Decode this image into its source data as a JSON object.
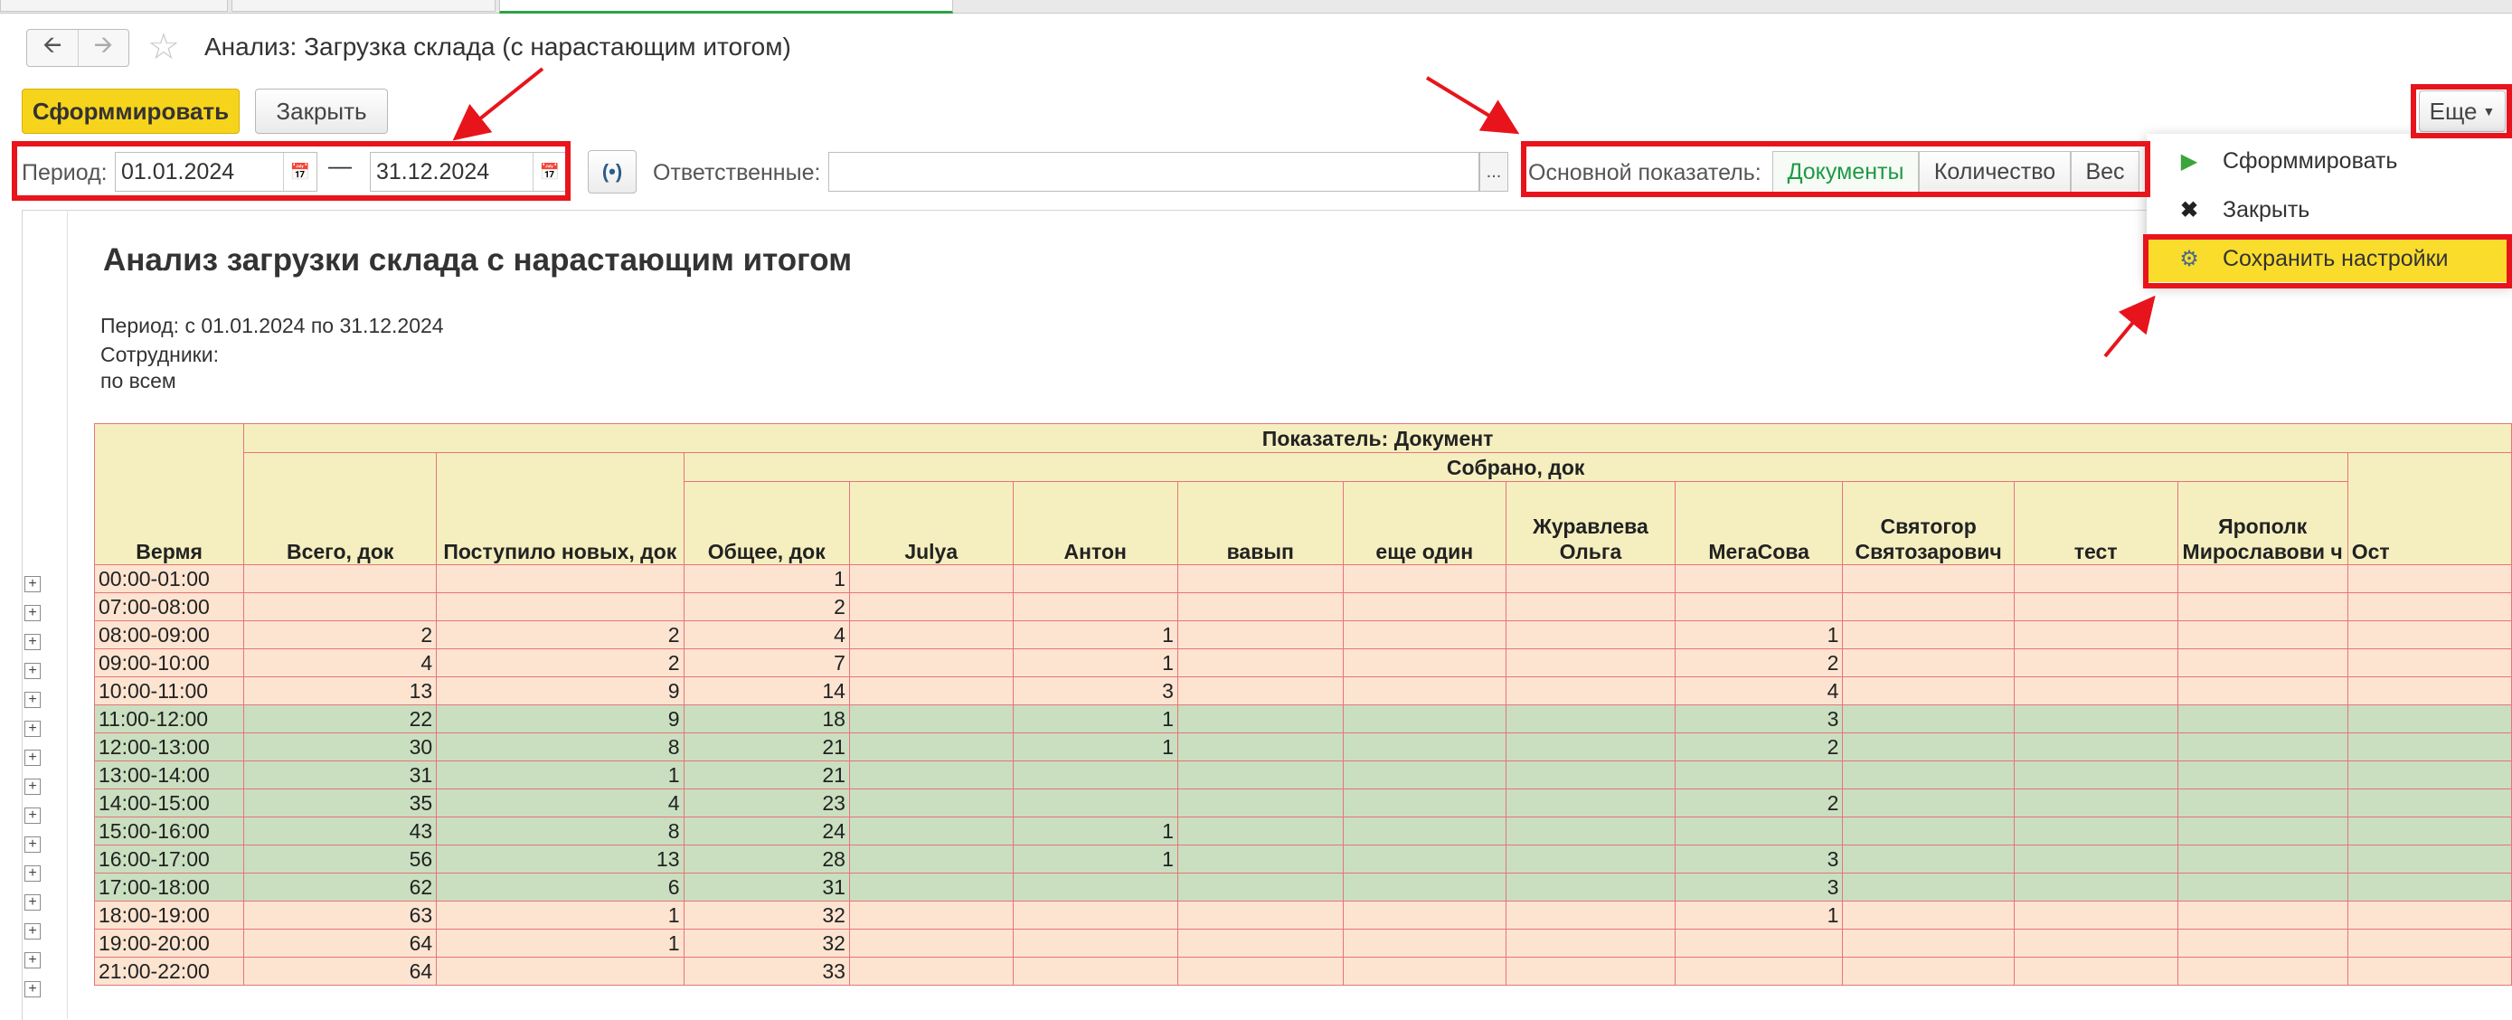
{
  "window": {
    "title": "Анализ: Загрузка склада (с нарастающим итогом)"
  },
  "toolbar": {
    "generate_label": "Сформмировать",
    "close_label": "Закрыть",
    "more_label": "Еще"
  },
  "filters": {
    "period_label": "Период:",
    "date_from": "01.01.2024",
    "date_to": "31.12.2024",
    "dash": "—",
    "responsible_label": "Ответственные:",
    "responsible_value": "",
    "dots": "...",
    "indicator_label": "Основной показатель:",
    "indicator_options": [
      "Документы",
      "Количество",
      "Вес"
    ],
    "indicator_selected": "Документы"
  },
  "menu": {
    "items": [
      {
        "label": "Сформмировать",
        "icon": "play-icon"
      },
      {
        "label": "Закрыть",
        "icon": "close-icon"
      },
      {
        "label": "Сохранить настройки",
        "icon": "settings-save-icon",
        "highlighted": true
      }
    ]
  },
  "report": {
    "title": "Анализ загрузки склада с нарастающим итогом",
    "period_line": "Период: с 01.01.2024 по 31.12.2024",
    "employees_label": "Сотрудники:",
    "employees_value": "по всем",
    "header_indicator": "Показатель: Документ",
    "header_collected": "Собрано, док",
    "columns": [
      "Вермя",
      "Всего, док",
      "Поступило новых, док",
      "Общее, док",
      "Julya",
      "Антон",
      "вавып",
      "еще один",
      "Журавлева Ольга",
      "МегаСова",
      "Святогор Святозарович",
      "тест",
      "Ярополк Мирославови ч",
      "Ост"
    ],
    "rows": [
      {
        "time": "00:00-01:00",
        "total": "",
        "new": "",
        "overall": "1",
        "julya": "",
        "anton": "",
        "vavyp": "",
        "eshe": "",
        "zhur": "",
        "mega": "",
        "svyat": "",
        "test": "",
        "yarop": "",
        "style": "peach"
      },
      {
        "time": "07:00-08:00",
        "total": "",
        "new": "",
        "overall": "2",
        "julya": "",
        "anton": "",
        "vavyp": "",
        "eshe": "",
        "zhur": "",
        "mega": "",
        "svyat": "",
        "test": "",
        "yarop": "",
        "style": "peach"
      },
      {
        "time": "08:00-09:00",
        "total": "2",
        "new": "2",
        "overall": "4",
        "julya": "",
        "anton": "1",
        "vavyp": "",
        "eshe": "",
        "zhur": "",
        "mega": "1",
        "svyat": "",
        "test": "",
        "yarop": "",
        "style": "peach"
      },
      {
        "time": "09:00-10:00",
        "total": "4",
        "new": "2",
        "overall": "7",
        "julya": "",
        "anton": "1",
        "vavyp": "",
        "eshe": "",
        "zhur": "",
        "mega": "2",
        "svyat": "",
        "test": "",
        "yarop": "",
        "style": "peach"
      },
      {
        "time": "10:00-11:00",
        "total": "13",
        "new": "9",
        "overall": "14",
        "julya": "",
        "anton": "3",
        "vavyp": "",
        "eshe": "",
        "zhur": "",
        "mega": "4",
        "svyat": "",
        "test": "",
        "yarop": "",
        "style": "peach"
      },
      {
        "time": "11:00-12:00",
        "total": "22",
        "new": "9",
        "overall": "18",
        "julya": "",
        "anton": "1",
        "vavyp": "",
        "eshe": "",
        "zhur": "",
        "mega": "3",
        "svyat": "",
        "test": "",
        "yarop": "",
        "style": "green"
      },
      {
        "time": "12:00-13:00",
        "total": "30",
        "new": "8",
        "overall": "21",
        "julya": "",
        "anton": "1",
        "vavyp": "",
        "eshe": "",
        "zhur": "",
        "mega": "2",
        "svyat": "",
        "test": "",
        "yarop": "",
        "style": "green"
      },
      {
        "time": "13:00-14:00",
        "total": "31",
        "new": "1",
        "overall": "21",
        "julya": "",
        "anton": "",
        "vavyp": "",
        "eshe": "",
        "zhur": "",
        "mega": "",
        "svyat": "",
        "test": "",
        "yarop": "",
        "style": "green"
      },
      {
        "time": "14:00-15:00",
        "total": "35",
        "new": "4",
        "overall": "23",
        "julya": "",
        "anton": "",
        "vavyp": "",
        "eshe": "",
        "zhur": "",
        "mega": "2",
        "svyat": "",
        "test": "",
        "yarop": "",
        "style": "green"
      },
      {
        "time": "15:00-16:00",
        "total": "43",
        "new": "8",
        "overall": "24",
        "julya": "",
        "anton": "1",
        "vavyp": "",
        "eshe": "",
        "zhur": "",
        "mega": "",
        "svyat": "",
        "test": "",
        "yarop": "",
        "style": "green"
      },
      {
        "time": "16:00-17:00",
        "total": "56",
        "new": "13",
        "overall": "28",
        "julya": "",
        "anton": "1",
        "vavyp": "",
        "eshe": "",
        "zhur": "",
        "mega": "3",
        "svyat": "",
        "test": "",
        "yarop": "",
        "style": "green"
      },
      {
        "time": "17:00-18:00",
        "total": "62",
        "new": "6",
        "overall": "31",
        "julya": "",
        "anton": "",
        "vavyp": "",
        "eshe": "",
        "zhur": "",
        "mega": "3",
        "svyat": "",
        "test": "",
        "yarop": "",
        "style": "green"
      },
      {
        "time": "18:00-19:00",
        "total": "63",
        "new": "1",
        "overall": "32",
        "julya": "",
        "anton": "",
        "vavyp": "",
        "eshe": "",
        "zhur": "",
        "mega": "1",
        "svyat": "",
        "test": "",
        "yarop": "",
        "style": "peach"
      },
      {
        "time": "19:00-20:00",
        "total": "64",
        "new": "1",
        "overall": "32",
        "julya": "",
        "anton": "",
        "vavyp": "",
        "eshe": "",
        "zhur": "",
        "mega": "",
        "svyat": "",
        "test": "",
        "yarop": "",
        "style": "peach"
      },
      {
        "time": "21:00-22:00",
        "total": "64",
        "new": "",
        "overall": "33",
        "julya": "",
        "anton": "",
        "vavyp": "",
        "eshe": "",
        "zhur": "",
        "mega": "",
        "svyat": "",
        "test": "",
        "yarop": "",
        "style": "peach"
      }
    ]
  },
  "colors": {
    "primary_button": "#f7d41c",
    "highlight_red": "#e8141c",
    "header_fill": "#f5efc0",
    "row_peach": "#fce4d1",
    "row_green": "#c9dfc0",
    "grid_line": "#e8737b",
    "active_option": "#1d9a45"
  }
}
